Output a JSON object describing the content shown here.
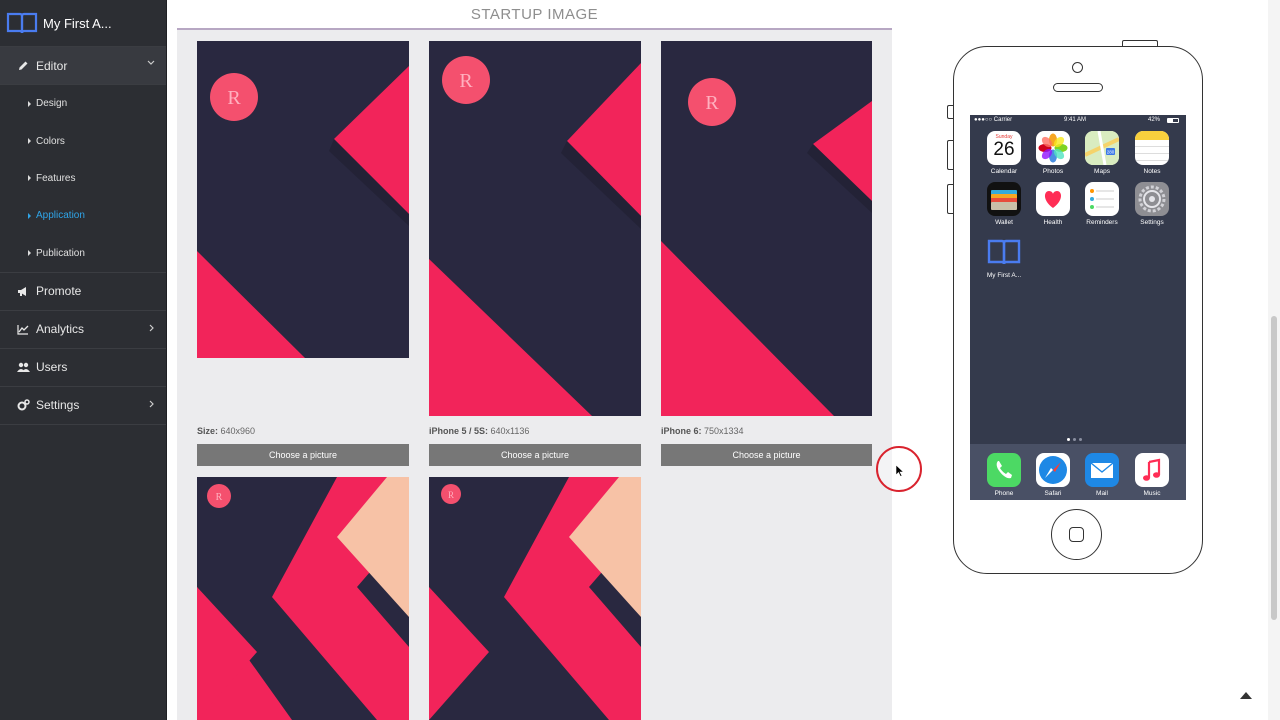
{
  "sidebar": {
    "app_name": "My First A...",
    "editor_label": "Editor",
    "sub_items": [
      "Design",
      "Colors",
      "Features",
      "Application",
      "Publication"
    ],
    "active_sub_item": "Application",
    "nav_items": [
      "Promote",
      "Analytics",
      "Users",
      "Settings"
    ]
  },
  "main": {
    "section_title": "STARTUP IMAGE",
    "cards": [
      {
        "label": "Size:",
        "value": " 640x960",
        "button": "Choose a picture"
      },
      {
        "label": "iPhone 5 / 5S:",
        "value": " 640x1136",
        "button": "Choose a picture"
      },
      {
        "label": "iPhone 6:",
        "value": " 750x1334",
        "button": "Choose a picture"
      }
    ]
  },
  "phone": {
    "carrier": "Carrier",
    "time": "9:41 AM",
    "battery": "42%",
    "calendar_day": "Sunday",
    "calendar_date": "26",
    "apps": [
      "Calendar",
      "Photos",
      "Maps",
      "Notes",
      "Wallet",
      "Health",
      "Reminders",
      "Settings",
      "My First A..."
    ],
    "dock": [
      "Phone",
      "Safari",
      "Mail",
      "Music"
    ]
  },
  "colors": {
    "accent_pink": "#f2245a",
    "dark_bg": "#292840",
    "active_blue": "#2fa4e7"
  }
}
